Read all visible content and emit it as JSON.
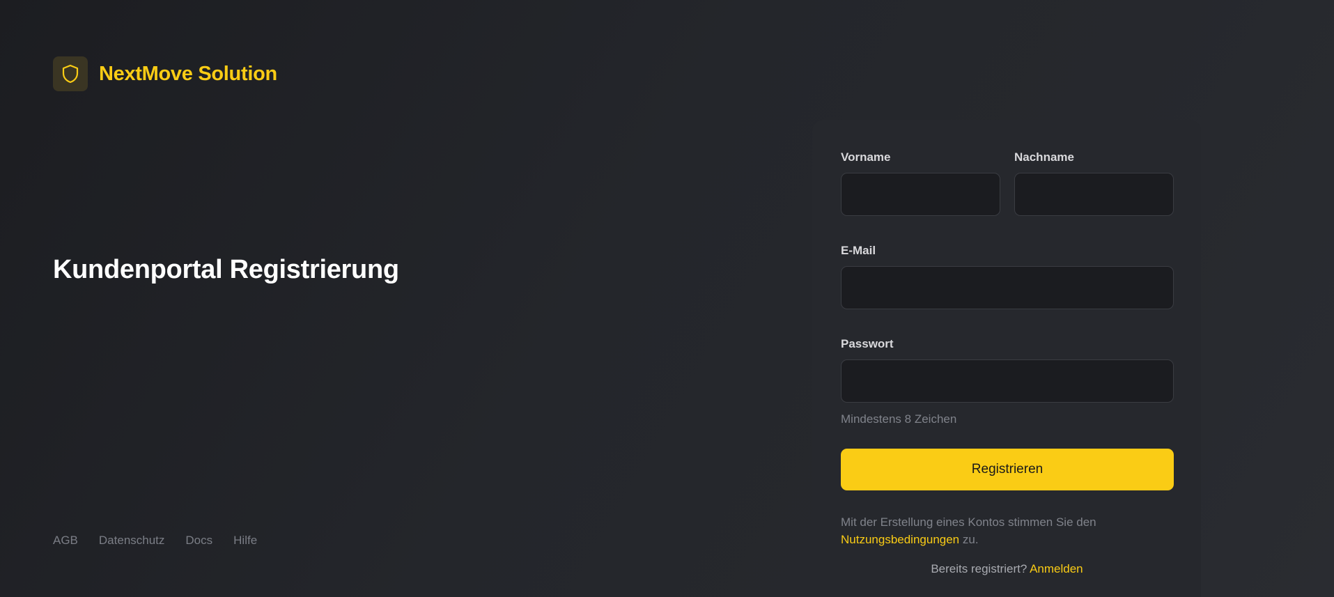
{
  "brand": {
    "name": "NextMove Solution",
    "icon": "shield-icon",
    "accent_color": "#facc15"
  },
  "page": {
    "title": "Kundenportal Registrierung"
  },
  "form": {
    "first_name": {
      "label": "Vorname",
      "value": ""
    },
    "last_name": {
      "label": "Nachname",
      "value": ""
    },
    "email": {
      "label": "E-Mail",
      "value": ""
    },
    "password": {
      "label": "Passwort",
      "value": "",
      "hint": "Mindestens 8 Zeichen"
    },
    "submit_label": "Registrieren",
    "terms_prefix": "Mit der Erstellung eines Kontos stimmen Sie den",
    "terms_link": "Nutzungsbedingungen",
    "terms_suffix": "zu.",
    "login_prompt": "Bereits registriert?",
    "login_link": "Anmelden"
  },
  "footer": {
    "links": [
      "AGB",
      "Datenschutz",
      "Docs",
      "Hilfe"
    ]
  }
}
